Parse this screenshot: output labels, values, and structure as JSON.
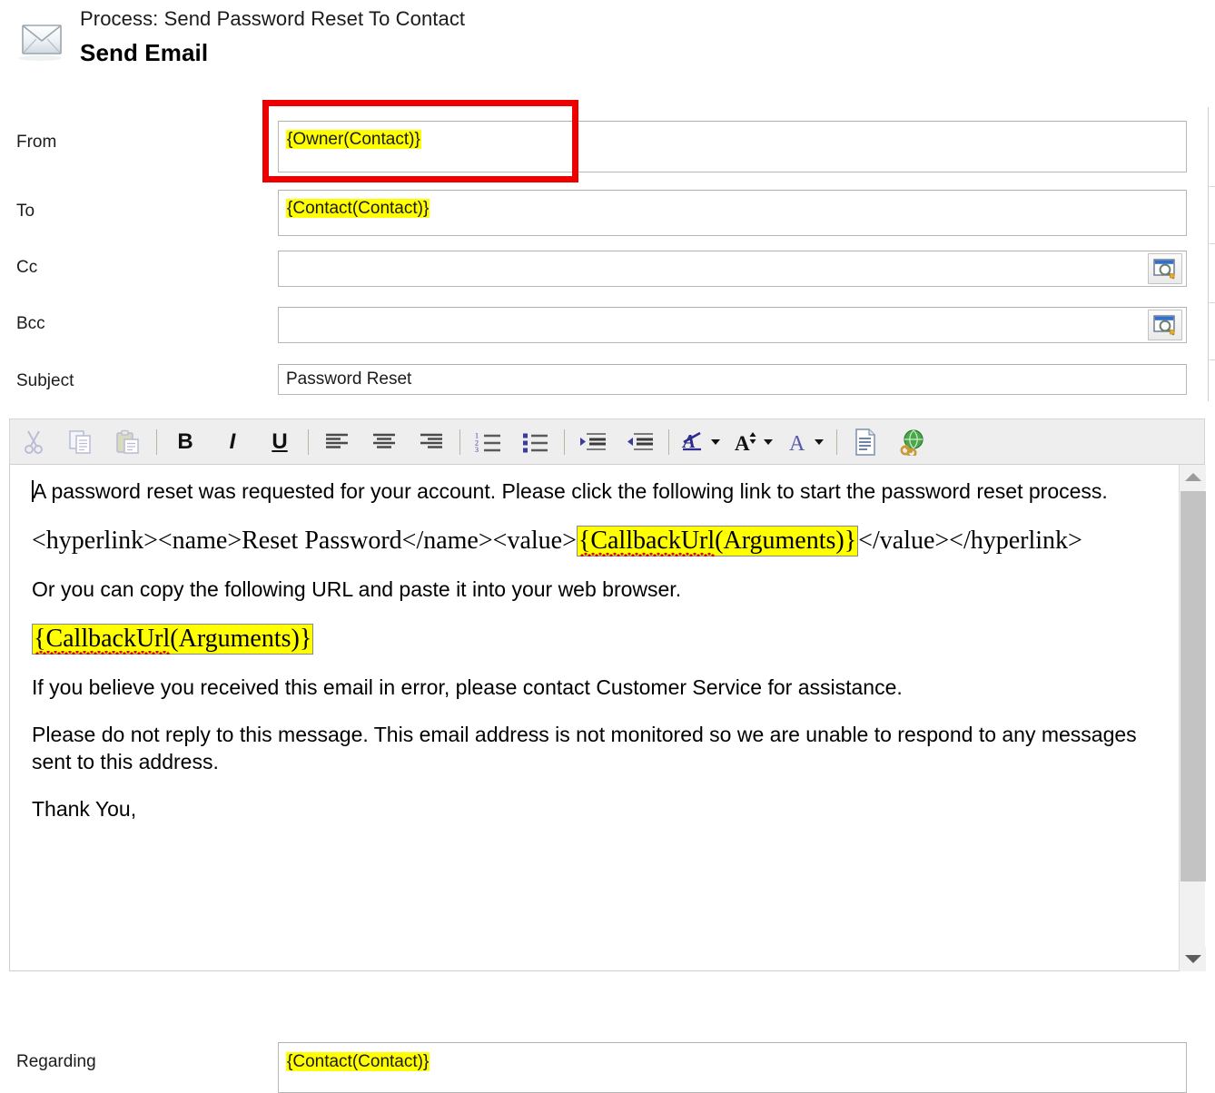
{
  "header": {
    "icon": "email-envelope-icon",
    "process_label": "Process: Send Password Reset To Contact",
    "title": "Send Email"
  },
  "form": {
    "fields": [
      {
        "label": "From",
        "value": "{Owner(Contact)}",
        "highlighted": true,
        "has_lookup": false
      },
      {
        "label": "To",
        "value": "{Contact(Contact)}",
        "highlighted": true,
        "has_lookup": false
      },
      {
        "label": "Cc",
        "value": "",
        "highlighted": false,
        "has_lookup": true
      },
      {
        "label": "Bcc",
        "value": "",
        "highlighted": false,
        "has_lookup": true
      },
      {
        "label": "Subject",
        "value": "Password Reset",
        "highlighted": false,
        "has_lookup": false
      }
    ],
    "regarding": {
      "label": "Regarding",
      "value": "{Contact(Contact)}",
      "highlighted": true
    }
  },
  "annotation": {
    "type": "red-rectangle-highlight",
    "color": "#ee0000",
    "targets": "from-field"
  },
  "toolbar": {
    "items": [
      {
        "name": "cut-icon",
        "label": "Cut",
        "disabled": true
      },
      {
        "name": "copy-icon",
        "label": "Copy",
        "disabled": true
      },
      {
        "name": "paste-icon",
        "label": "Paste",
        "disabled": true
      },
      {
        "name": "bold-icon",
        "label": "B",
        "disabled": false
      },
      {
        "name": "italic-icon",
        "label": "I",
        "disabled": false
      },
      {
        "name": "underline-icon",
        "label": "U",
        "disabled": false
      },
      {
        "name": "align-left-icon",
        "label": "Align Left",
        "disabled": false
      },
      {
        "name": "align-center-icon",
        "label": "Align Center",
        "disabled": false
      },
      {
        "name": "align-right-icon",
        "label": "Align Right",
        "disabled": false
      },
      {
        "name": "numbered-list-icon",
        "label": "Numbered List",
        "disabled": false
      },
      {
        "name": "bulleted-list-icon",
        "label": "Bulleted List",
        "disabled": false
      },
      {
        "name": "increase-indent-icon",
        "label": "Increase Indent",
        "disabled": false
      },
      {
        "name": "decrease-indent-icon",
        "label": "Decrease Indent",
        "disabled": false
      },
      {
        "name": "font-style-icon",
        "label": "Font",
        "disabled": false
      },
      {
        "name": "font-size-icon",
        "label": "Font Size",
        "disabled": false
      },
      {
        "name": "font-color-icon",
        "label": "Font Color",
        "disabled": false
      },
      {
        "name": "insert-article-icon",
        "label": "Insert Article",
        "disabled": false
      },
      {
        "name": "insert-hyperlink-icon",
        "label": "Insert Hyperlink",
        "disabled": false
      }
    ]
  },
  "body": {
    "paragraphs": [
      {
        "style": "sans",
        "caret": true,
        "runs": [
          {
            "text": "A password reset was requested for your account. Please click the following link to start the password reset process."
          }
        ]
      },
      {
        "style": "serif",
        "runs": [
          {
            "text": "<hyperlink><name>Reset Password</name><value>"
          },
          {
            "text": "{CallbackUrl(Arguments)}",
            "token": true,
            "spellerror": true
          },
          {
            "text": "</value></hyperlink>"
          }
        ]
      },
      {
        "style": "sans",
        "runs": [
          {
            "text": "Or you can copy the following URL and paste it into your web browser."
          }
        ]
      },
      {
        "style": "serif",
        "runs": [
          {
            "text": "{CallbackUrl(Arguments)}",
            "token": true,
            "spellerror": true
          }
        ]
      },
      {
        "style": "sans",
        "runs": [
          {
            "text": "If you believe you received this email in error, please contact Customer Service for assistance."
          }
        ]
      },
      {
        "style": "sans",
        "runs": [
          {
            "text": "Please do not reply to this message. This email address is not monitored so we are unable to respond to any messages sent to this address."
          }
        ]
      },
      {
        "style": "sans",
        "runs": [
          {
            "text": "Thank You,"
          }
        ]
      }
    ]
  },
  "scrollbar": {
    "up": "scroll-up-arrow",
    "down": "scroll-down-arrow",
    "thumb_position": "top"
  },
  "colors": {
    "highlight": "#ffff00",
    "annotation_red": "#ee0000",
    "toolbar_bg": "#eeeeee",
    "field_border": "#b7b7b7",
    "text": "#1b1b1b"
  }
}
